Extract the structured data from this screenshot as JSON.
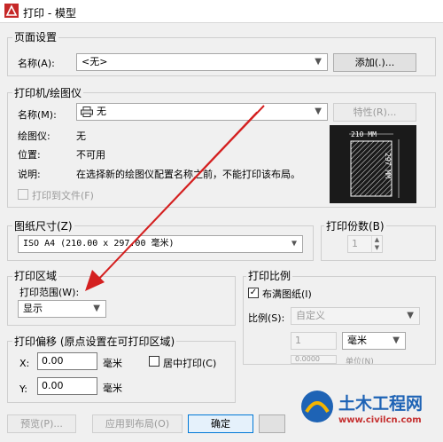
{
  "window": {
    "title": "打印 - 模型"
  },
  "page_setup": {
    "group_title": "页面设置",
    "name_label": "名称(A):",
    "name_value": "<无>",
    "add_button": "添加(.)..."
  },
  "printer": {
    "group_title": "打印机/绘图仪",
    "name_label": "名称(M):",
    "name_value": "无",
    "properties_button": "特性(R)...",
    "plotter_label": "绘图仪:",
    "plotter_value": "无",
    "location_label": "位置:",
    "location_value": "不可用",
    "description_label": "说明:",
    "description_value": "在选择新的绘图仪配置名称之前，不能打印该布局。",
    "print_to_file_label": "打印到文件(F)",
    "print_to_file_checked": false,
    "preview_width": "210 MM",
    "preview_height": "297 MM"
  },
  "paper_size": {
    "group_title": "图纸尺寸(Z)",
    "value": "ISO A4 (210.00 x 297.00 毫米)"
  },
  "copies": {
    "group_title": "打印份数(B)",
    "value": "1"
  },
  "plot_area": {
    "group_title": "打印区域",
    "range_label": "打印范围(W):",
    "range_value": "显示"
  },
  "plot_scale": {
    "group_title": "打印比例",
    "fit_label": "布满图纸(I)",
    "fit_checked": true,
    "scale_label": "比例(S):",
    "scale_value": "自定义",
    "scale_a": "1",
    "unit_value": "毫米",
    "scale_b": "0.0000",
    "unit_b_label": "单位(N)"
  },
  "plot_offset": {
    "group_title": "打印偏移 (原点设置在可打印区域)",
    "x_label": "X:",
    "x_value": "0.00",
    "x_unit": "毫米",
    "y_label": "Y:",
    "y_value": "0.00",
    "y_unit": "毫米",
    "center_label": "居中打印(C)",
    "center_checked": false
  },
  "footer": {
    "preview_button": "预览(P)...",
    "apply_button": "应用到布局(O)",
    "ok_button": "确定"
  },
  "watermark": {
    "brand": "土木工程网",
    "url": "www.civilcn.com"
  },
  "colors": {
    "annotation_arrow": "#d42020",
    "ok_border": "#0078d7"
  }
}
